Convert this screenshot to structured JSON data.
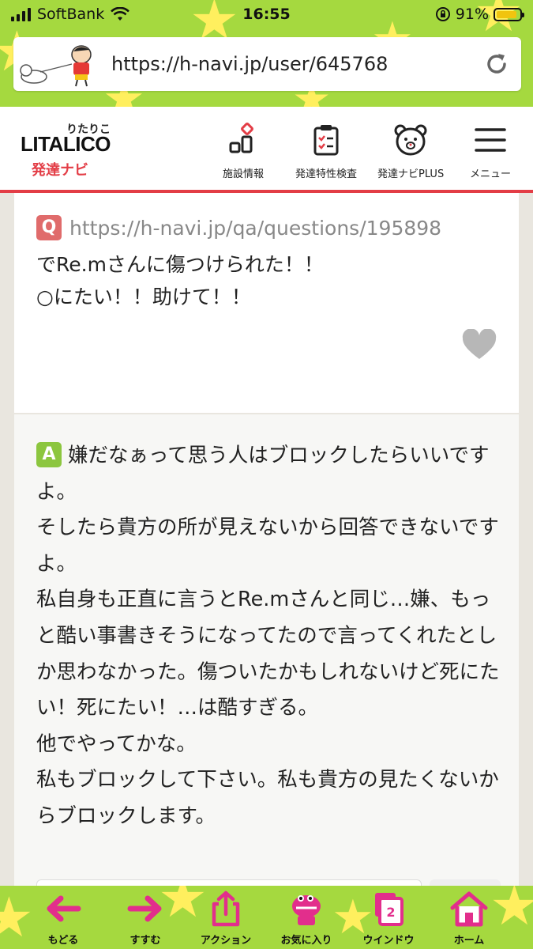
{
  "status_bar": {
    "carrier": "SoftBank",
    "time": "16:55",
    "battery": "91%",
    "battery_level": 0.91
  },
  "browser": {
    "url": "https://h-navi.jp/user/645768"
  },
  "site": {
    "logo_ruby": "りたりこ",
    "logo_brand": "LITALICO",
    "logo_sub": "発達ナビ",
    "nav": [
      {
        "label": "施設情報",
        "icon": "facility-icon"
      },
      {
        "label": "発達特性検査",
        "icon": "clipboard-icon"
      },
      {
        "label": "発達ナビPLUS",
        "icon": "bear-icon"
      },
      {
        "label": "メニュー",
        "icon": "menu-icon"
      }
    ],
    "accent_color": "#e33d46"
  },
  "question": {
    "badge": "Q",
    "link": "https://h-navi.jp/qa/questions/195898",
    "text": "でRe.mさんに傷つけられた！！\n○にたい！！助けて！！"
  },
  "answer": {
    "badge": "A",
    "text": "嫌だなぁって思う人はブロックしたらいいですよ。\nそしたら貴方の所が見えないから回答できないですよ。\n私自身も正直に言うとRe.mさんと同じ…嫌、もっと酷い事書きそうになってたので言ってくれたとしか思わなかった。傷ついたかもしれないけど死にたい！死にたい！…は酷すぎる。\n他でやってかな。\n私もブロックして下さい。私も貴方の見たくないからブロックします。"
  },
  "toolbar": {
    "items": [
      {
        "label": "もどる",
        "icon": "back-arrow-icon"
      },
      {
        "label": "すすむ",
        "icon": "forward-arrow-icon"
      },
      {
        "label": "アクション",
        "icon": "share-icon"
      },
      {
        "label": "お気に入り",
        "icon": "favorites-mascot-icon"
      },
      {
        "label": "ウインドウ",
        "icon": "window-icon",
        "count": "2"
      },
      {
        "label": "ホーム",
        "icon": "home-icon"
      }
    ]
  }
}
